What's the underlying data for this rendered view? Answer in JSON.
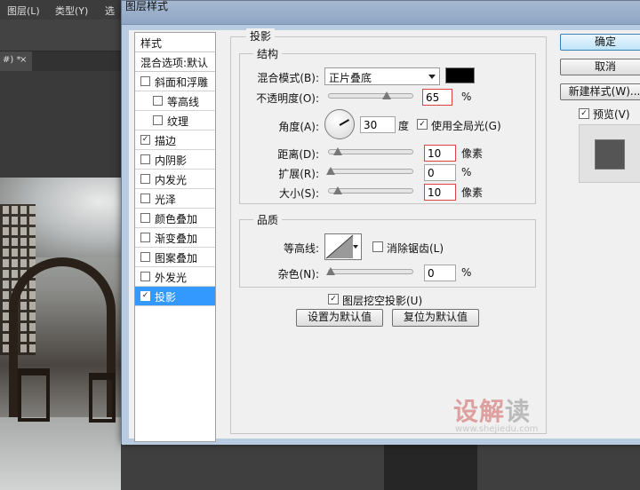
{
  "background_app": {
    "menu": [
      "图层(L)",
      "类型(Y)",
      "选"
    ],
    "doc_tab": "#) *",
    "tab_close": "×"
  },
  "dialog": {
    "title": "图层样式",
    "style_list": {
      "header": "样式",
      "blend_options": "混合选项:默认",
      "items": [
        {
          "label": "斜面和浮雕",
          "checked": false,
          "indent": false
        },
        {
          "label": "等高线",
          "checked": false,
          "indent": true
        },
        {
          "label": "纹理",
          "checked": false,
          "indent": true
        },
        {
          "label": "描边",
          "checked": true,
          "indent": false
        },
        {
          "label": "内阴影",
          "checked": false,
          "indent": false
        },
        {
          "label": "内发光",
          "checked": false,
          "indent": false
        },
        {
          "label": "光泽",
          "checked": false,
          "indent": false
        },
        {
          "label": "颜色叠加",
          "checked": false,
          "indent": false
        },
        {
          "label": "渐变叠加",
          "checked": false,
          "indent": false
        },
        {
          "label": "图案叠加",
          "checked": false,
          "indent": false
        },
        {
          "label": "外发光",
          "checked": false,
          "indent": false
        },
        {
          "label": "投影",
          "checked": true,
          "indent": false,
          "selected": true
        }
      ]
    },
    "drop_shadow": {
      "section_title": "投影",
      "structure": {
        "title": "结构",
        "blend_mode_label": "混合模式(B):",
        "blend_mode_value": "正片叠底",
        "blend_color": "#000000",
        "opacity_label": "不透明度(O):",
        "opacity_value": "65",
        "opacity_unit": "%",
        "angle_label": "角度(A):",
        "angle_value": "30",
        "angle_unit": "度",
        "global_light_label": "使用全局光(G)",
        "global_light_checked": true,
        "distance_label": "距离(D):",
        "distance_value": "10",
        "distance_unit": "像素",
        "spread_label": "扩展(R):",
        "spread_value": "0",
        "spread_unit": "%",
        "size_label": "大小(S):",
        "size_value": "10",
        "size_unit": "像素"
      },
      "quality": {
        "title": "品质",
        "contour_label": "等高线:",
        "anti_alias_label": "消除锯齿(L)",
        "anti_alias_checked": false,
        "noise_label": "杂色(N):",
        "noise_value": "0",
        "noise_unit": "%"
      },
      "knockout_label": "图层挖空投影(U)",
      "knockout_checked": true,
      "make_default": "设置为默认值",
      "reset_default": "复位为默认值"
    },
    "buttons": {
      "ok": "确定",
      "cancel": "取消",
      "new_style": "新建样式(W)...",
      "preview_label": "预览(V)",
      "preview_checked": true
    }
  },
  "watermark": {
    "red": "设解",
    "gray": "读",
    "url": "www.shejiedu.com"
  },
  "check_mark": "✓"
}
